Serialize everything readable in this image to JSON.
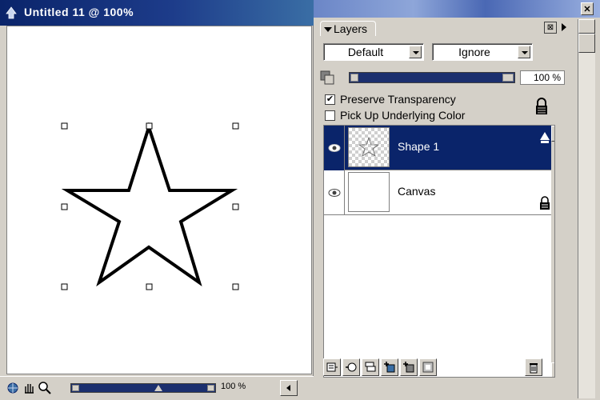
{
  "document": {
    "title": "Untitled 11 @ 100%",
    "zoom": "100 %"
  },
  "layers_panel": {
    "tab_label": "Layers",
    "blend_mode": "Default",
    "edge_mode": "Ignore",
    "opacity": "100 %",
    "preserve_transparency": {
      "label": "Preserve Transparency",
      "checked": true
    },
    "pick_up_underlying": {
      "label": "Pick Up Underlying Color",
      "checked": false
    },
    "layers": [
      {
        "name": "Shape 1",
        "selected": true
      },
      {
        "name": "Canvas",
        "selected": false
      }
    ]
  },
  "icons": {
    "app": "app-icon",
    "close": "close-icon",
    "lock": "lock-icon",
    "eye": "eye-icon",
    "trash": "trash-icon"
  },
  "colors": {
    "selection": "#0a246a",
    "titlebar": "#1d3c8a",
    "slider_track": "#1b2f6e"
  }
}
